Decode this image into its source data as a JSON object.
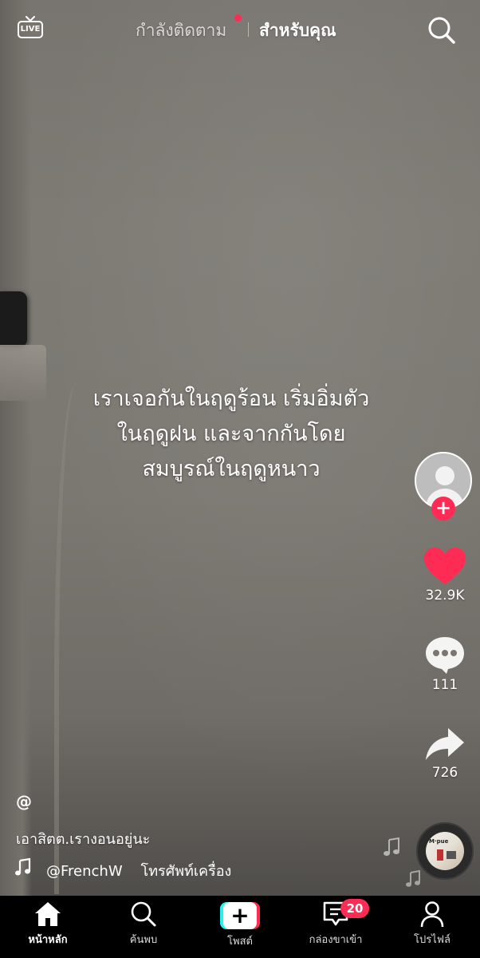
{
  "top_bar": {
    "live_label": "LIVE",
    "tab_following": "กำลังติดตาม",
    "tab_for_you": "สำหรับคุณ"
  },
  "video": {
    "overlay_text": "เราเจอกันในฤดูร้อน เริ่มอิ่มตัว\nในฤดูฝน และจากกันโดย\nสมบูรณ์ในฤดูหนาว"
  },
  "actions": {
    "likes": "32.9K",
    "comments": "111",
    "shares": "726",
    "follow_symbol": "+"
  },
  "info": {
    "username": "@",
    "description": "เอาสิตต.เรางอนอยู่นะ",
    "music": "@FrenchW    โทรศัพท์เครื่อง"
  },
  "disc": {
    "cover_text": "M·pue"
  },
  "bottom_nav": {
    "home": "หน้าหลัก",
    "discover": "ค้นพบ",
    "post": "โพสต์",
    "post_symbol": "+",
    "inbox": "กล่องขาเข้า",
    "inbox_badge": "20",
    "profile": "โปรไฟล์"
  },
  "colors": {
    "accent": "#fe2c55",
    "cyan": "#25f4ee"
  }
}
